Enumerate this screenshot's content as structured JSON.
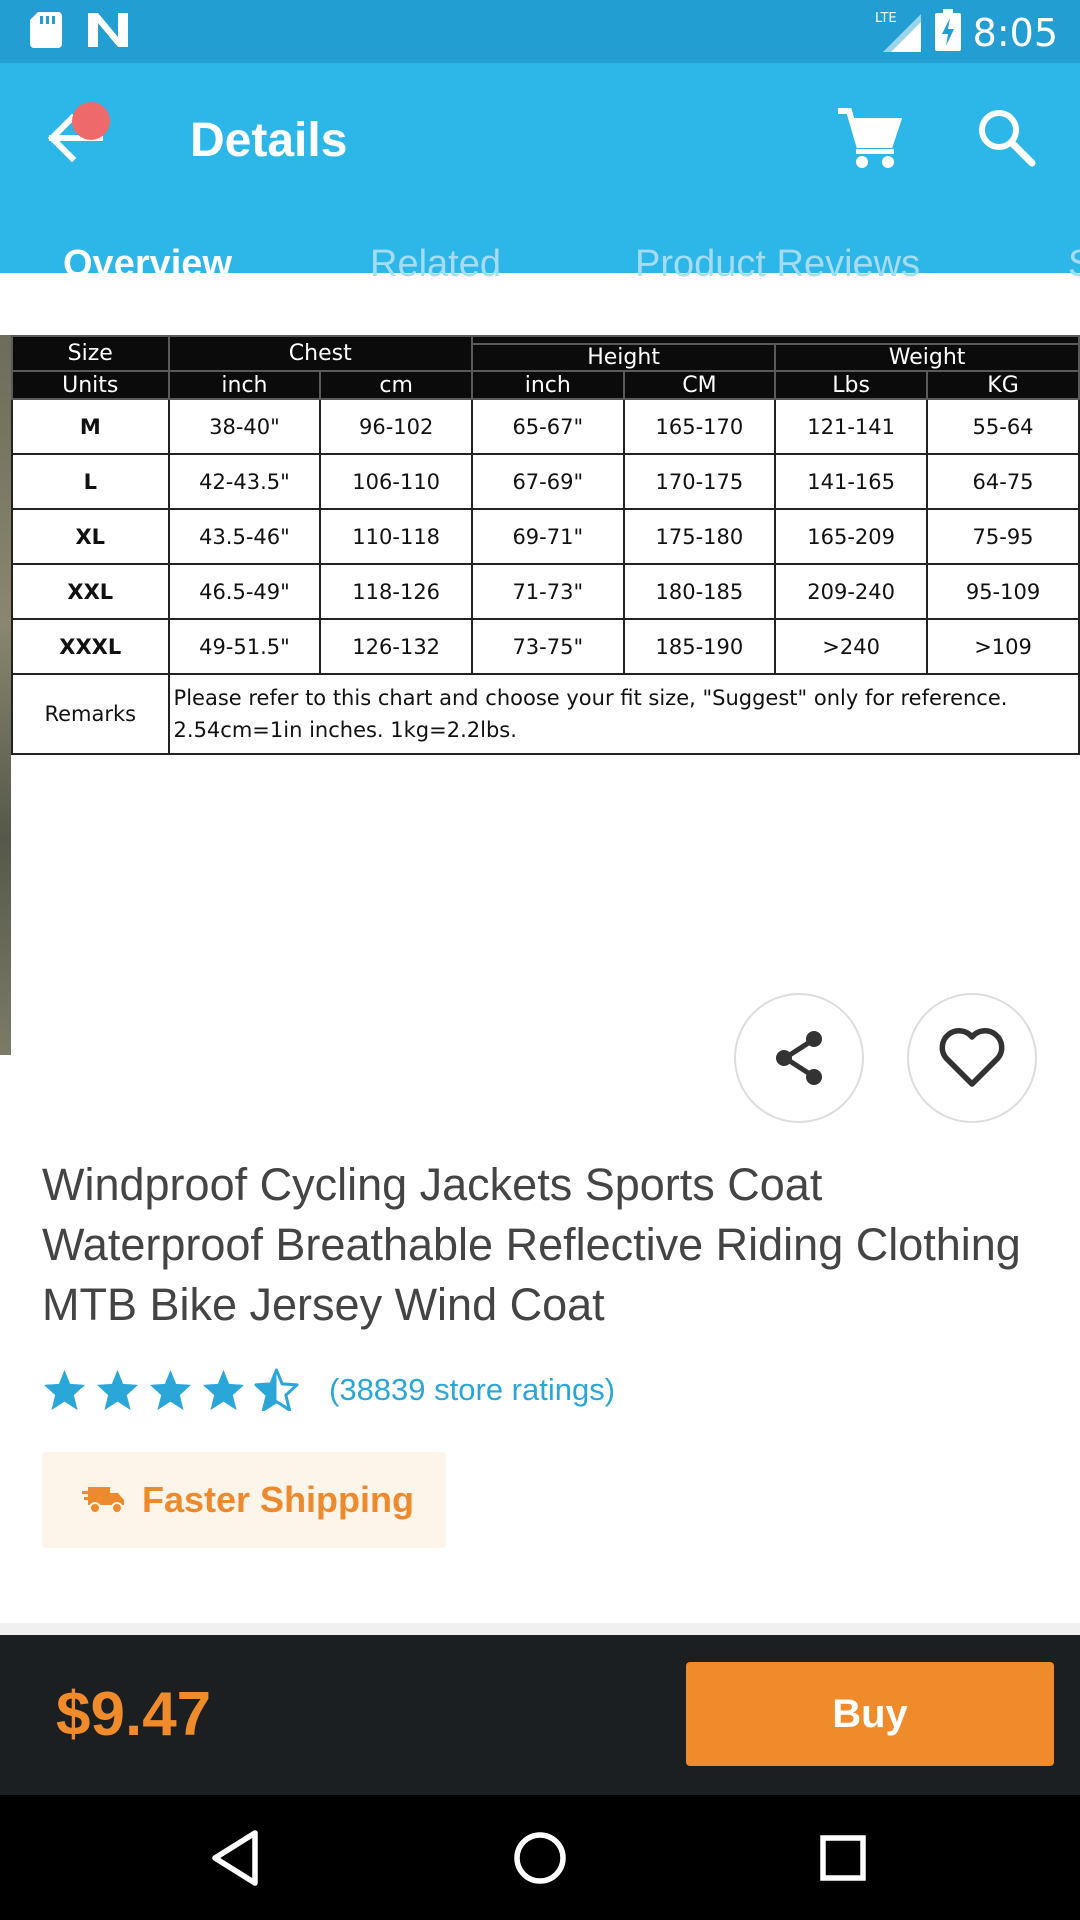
{
  "status_bar": {
    "time": "8:05",
    "network": "LTE",
    "icons": [
      "sd-card-icon",
      "n-notification-icon",
      "lte-signal-icon",
      "battery-charging-icon"
    ]
  },
  "app_bar": {
    "title": "Details",
    "icons": [
      "back-arrow-icon",
      "cart-icon",
      "search-icon"
    ],
    "notification_dot_color": "#ee6a6a"
  },
  "tabs": [
    {
      "label": "Overview",
      "active": true
    },
    {
      "label": "Related",
      "active": false
    },
    {
      "label": "Product Reviews",
      "active": false
    },
    {
      "label": "S",
      "active": false
    }
  ],
  "size_chart": {
    "header_groups": {
      "size": "Size",
      "chest": "Chest",
      "height": "Height",
      "weight": "Weight"
    },
    "units": [
      "Units",
      "inch",
      "cm",
      "inch",
      "CM",
      "Lbs",
      "KG"
    ],
    "rows": [
      [
        "M",
        "38-40\"",
        "96-102",
        "65-67\"",
        "165-170",
        "121-141",
        "55-64"
      ],
      [
        "L",
        "42-43.5\"",
        "106-110",
        "67-69\"",
        "170-175",
        "141-165",
        "64-75"
      ],
      [
        "XL",
        "43.5-46\"",
        "110-118",
        "69-71\"",
        "175-180",
        "165-209",
        "75-95"
      ],
      [
        "XXL",
        "46.5-49\"",
        "118-126",
        "71-73\"",
        "180-185",
        "209-240",
        "95-109"
      ],
      [
        "XXXL",
        "49-51.5\"",
        "126-132",
        "73-75\"",
        "185-190",
        ">240",
        ">109"
      ]
    ],
    "remarks_label": "Remarks",
    "remarks_line1": "Please refer to this chart and choose your fit size, \"Suggest\" only for reference.",
    "remarks_line2": "2.54cm=1in inches. 1kg=2.2lbs."
  },
  "actions": {
    "share_icon": "share-icon",
    "favorite_icon": "heart-icon"
  },
  "product": {
    "title": "Windproof Cycling Jackets Sports Coat Waterproof Breathable Reflective Riding Clothing MTB Bike Jersey Wind Coat",
    "rating_stars": 4.5,
    "rating_text": "(38839 store ratings)",
    "shipping_label": "Faster Shipping"
  },
  "buy_bar": {
    "price": "$9.47",
    "buy_label": "Buy"
  },
  "nav_bar": {
    "icons": [
      "back-triangle-icon",
      "home-circle-icon",
      "recents-square-icon"
    ]
  },
  "colors": {
    "status_bar": "#239ed3",
    "app_bar": "#2db6e8",
    "accent_orange": "#f08b2b",
    "rating_blue": "#2ba6d9",
    "buy_bar_bg": "#1c1f22"
  }
}
